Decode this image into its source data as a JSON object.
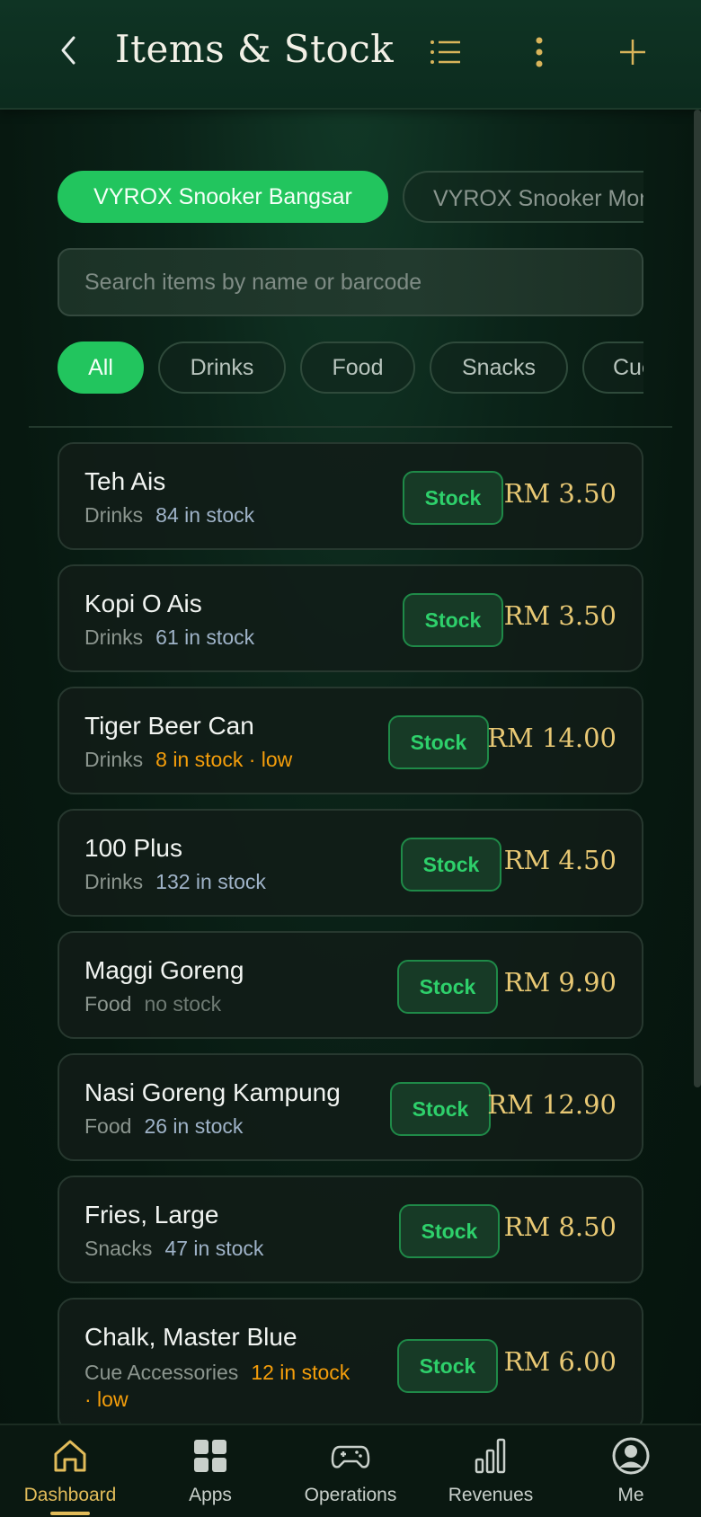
{
  "header": {
    "title": "Items & Stock"
  },
  "locations": [
    {
      "label": "VYROX Snooker Bangsar",
      "active": true
    },
    {
      "label": "VYROX Snooker Mont Kiara",
      "active": false
    }
  ],
  "search": {
    "placeholder": "Search items by name or barcode",
    "value": ""
  },
  "categories": [
    {
      "label": "All",
      "active": true
    },
    {
      "label": "Drinks",
      "active": false
    },
    {
      "label": "Food",
      "active": false
    },
    {
      "label": "Snacks",
      "active": false
    },
    {
      "label": "Cue Accessories",
      "active": false
    }
  ],
  "stock_button_label": "Stock",
  "items": [
    {
      "name": "Teh Ais",
      "category": "Drinks",
      "stock_text": "84 in stock",
      "status": "normal",
      "price": "RM 3.50"
    },
    {
      "name": "Kopi O Ais",
      "category": "Drinks",
      "stock_text": "61 in stock",
      "status": "normal",
      "price": "RM 3.50"
    },
    {
      "name": "Tiger Beer Can",
      "category": "Drinks",
      "stock_text": "8 in stock · low",
      "status": "low",
      "price": "RM 14.00"
    },
    {
      "name": "100 Plus",
      "category": "Drinks",
      "stock_text": "132 in stock",
      "status": "normal",
      "price": "RM 4.50"
    },
    {
      "name": "Maggi Goreng",
      "category": "Food",
      "stock_text": "no stock",
      "status": "none",
      "price": "RM 9.90"
    },
    {
      "name": "Nasi Goreng Kampung",
      "category": "Food",
      "stock_text": "26 in stock",
      "status": "normal",
      "price": "RM 12.90"
    },
    {
      "name": "Fries, Large",
      "category": "Snacks",
      "stock_text": "47 in stock",
      "status": "normal",
      "price": "RM 8.50"
    },
    {
      "name": "Chalk, Master Blue",
      "category": "Cue Accessories",
      "stock_text": "12 in stock",
      "stock_text_line2": "· low",
      "status": "low",
      "price": "RM 6.00"
    }
  ],
  "colors": {
    "accent": "#22c55e",
    "price": "#e8c874",
    "low": "#f59e0b",
    "stock_ok": "#9fb3c8",
    "nav_active": "#e2bc5a"
  },
  "bottom_nav": [
    {
      "label": "Dashboard",
      "icon": "home-icon",
      "active": true
    },
    {
      "label": "Apps",
      "icon": "apps-grid-icon",
      "active": false
    },
    {
      "label": "Operations",
      "icon": "gamepad-icon",
      "active": false
    },
    {
      "label": "Revenues",
      "icon": "bar-chart-icon",
      "active": false
    },
    {
      "label": "Me",
      "icon": "user-avatar-icon",
      "active": false
    }
  ]
}
